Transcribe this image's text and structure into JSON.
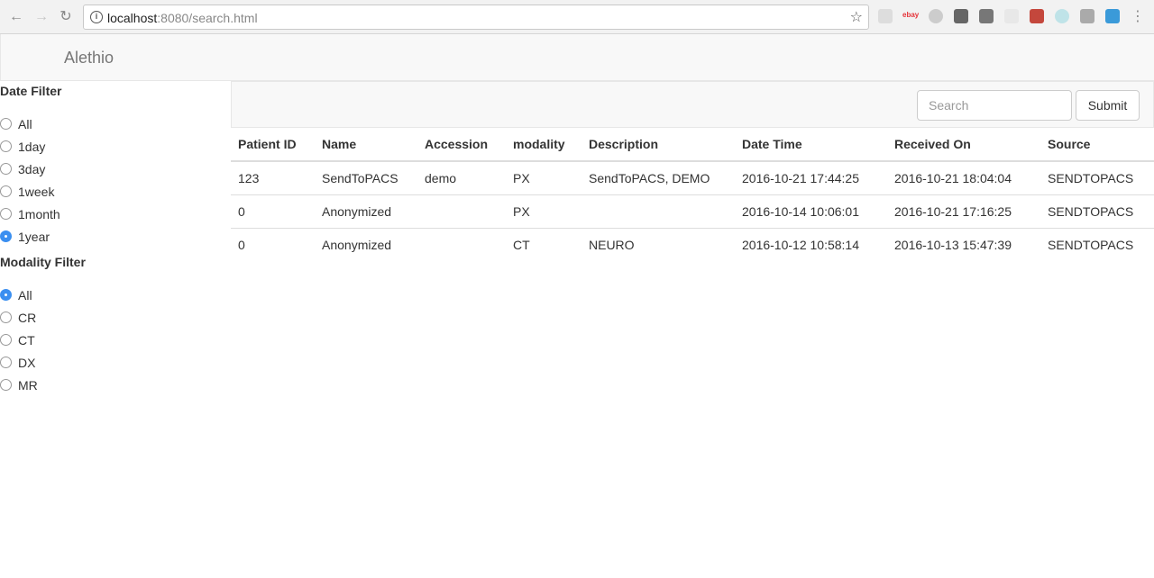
{
  "browser": {
    "url_host": "localhost",
    "url_path": ":8080/search.html"
  },
  "navbar": {
    "brand": "Alethio"
  },
  "sidebar": {
    "date_filter": {
      "title": "Date Filter",
      "options": [
        "All",
        "1day",
        "3day",
        "1week",
        "1month",
        "1year"
      ],
      "selected": "1year"
    },
    "modality_filter": {
      "title": "Modality Filter",
      "options": [
        "All",
        "CR",
        "CT",
        "DX",
        "MR"
      ],
      "selected": "All"
    }
  },
  "search": {
    "placeholder": "Search",
    "value": "",
    "submit_label": "Submit"
  },
  "table": {
    "columns": [
      "Patient ID",
      "Name",
      "Accession",
      "modality",
      "Description",
      "Date Time",
      "Received On",
      "Source"
    ],
    "rows": [
      [
        "123",
        "SendToPACS",
        "demo",
        "PX",
        "SendToPACS, DEMO",
        "2016-10-21 17:44:25",
        "2016-10-21 18:04:04",
        "SENDTOPACS"
      ],
      [
        "0",
        "Anonymized",
        "",
        "PX",
        "",
        "2016-10-14 10:06:01",
        "2016-10-21 17:16:25",
        "SENDTOPACS"
      ],
      [
        "0",
        "Anonymized",
        "",
        "CT",
        "NEURO",
        "2016-10-12 10:58:14",
        "2016-10-13 15:47:39",
        "SENDTOPACS"
      ]
    ]
  },
  "icons": {
    "back": "arrow-left-icon",
    "forward": "arrow-right-icon",
    "reload": "reload-icon",
    "info": "info-icon",
    "bookmark": "star-icon"
  },
  "colors": {
    "radio_checked": "#3b8ff0",
    "navbar_bg": "#f8f8f8"
  }
}
